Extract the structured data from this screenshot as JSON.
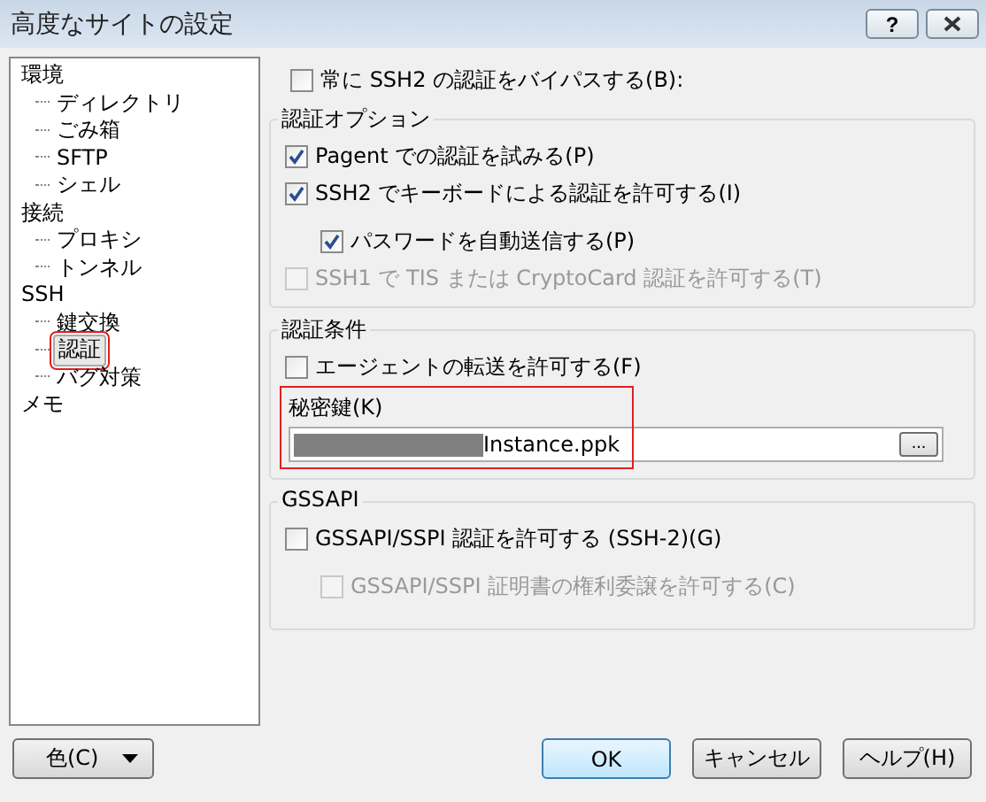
{
  "window": {
    "title": "高度なサイトの設定",
    "help_button": "?"
  },
  "tree": [
    {
      "label": "環境",
      "selected": false,
      "children": [
        {
          "label": "ディレクトリ",
          "selected": false
        },
        {
          "label": "ごみ箱",
          "selected": false
        },
        {
          "label": "SFTP",
          "selected": false
        },
        {
          "label": "シェル",
          "selected": false
        }
      ]
    },
    {
      "label": "接続",
      "selected": false,
      "children": [
        {
          "label": "プロキシ",
          "selected": false
        },
        {
          "label": "トンネル",
          "selected": false
        }
      ]
    },
    {
      "label": "SSH",
      "selected": false,
      "children": [
        {
          "label": "鍵交換",
          "selected": false
        },
        {
          "label": "認証",
          "selected": true
        },
        {
          "label": "バグ対策",
          "selected": false
        }
      ]
    },
    {
      "label": "メモ",
      "selected": false
    }
  ],
  "bypass": {
    "label": "常に SSH2 の認証をバイパスする(B):",
    "checked": false
  },
  "auth_options": {
    "title": "認証オプション",
    "items": [
      {
        "label": "Pagent での認証を試みる(P)",
        "checked": true,
        "disabled": false
      },
      {
        "label": "SSH2 でキーボードによる認証を許可する(I)",
        "checked": true,
        "disabled": false,
        "children": [
          {
            "label": "パスワードを自動送信する(P)",
            "checked": true,
            "disabled": false
          }
        ]
      },
      {
        "label": "SSH1 で TIS または CryptoCard 認証を許可する(T)",
        "checked": false,
        "disabled": true
      }
    ]
  },
  "auth_params": {
    "title": "認証条件",
    "items": [
      {
        "label": "エージェントの転送を許可する(F)",
        "checked": false,
        "disabled": false
      }
    ],
    "key_label": "秘密鍵(K)",
    "key_value": "Instance.ppk",
    "browse_button": "..."
  },
  "gssapi": {
    "title": "GSSAPI",
    "items": [
      {
        "label": "GSSAPI/SSPI 認証を許可する (SSH-2)(G)",
        "checked": false,
        "disabled": false,
        "children": [
          {
            "label": "GSSAPI/SSPI 証明書の権利委譲を許可する(C)",
            "checked": false,
            "disabled": true
          }
        ]
      }
    ]
  },
  "buttons": {
    "color_menu": "色(C)",
    "ok": "OK",
    "cancel": "キャンセル",
    "help": "ヘルプ(H)"
  }
}
